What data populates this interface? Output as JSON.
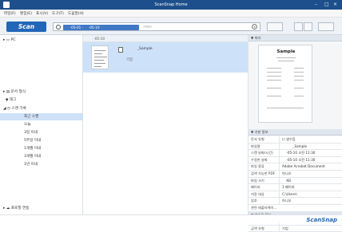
{
  "window": {
    "title": "ScanSnap Home",
    "minimize": "–",
    "maximize": "□",
    "close": "×"
  },
  "menu": [
    "파일(F)",
    "편집(E)",
    "표시(V)",
    "도구(T)",
    "도움말(H)"
  ],
  "toolbar": {
    "scan_label": "Scan",
    "search_chip": "     -05-01 -     -05-10",
    "search_placeholder": "키워드",
    "clear": "×"
  },
  "tree": {
    "pc": "PC",
    "doc_type": "문서 형식",
    "tags": "태그",
    "scan_history": "스캔 기록",
    "history_items": [
      "최근 스캔",
      "오늘",
      "3일 이내",
      "5주일 이내",
      "1개월 이내",
      "3개월 이내",
      "1년 이내"
    ],
    "cloud": "프로필 연동"
  },
  "list": {
    "header": "    -05-10",
    "item": {
      "name": "          _Sample",
      "date": "        ",
      "tag": "기업"
    }
  },
  "preview": {
    "header": "미리",
    "doc_title": "Sample"
  },
  "properties": {
    "header": "기본 정보",
    "rows": [
      {
        "k": "문서 유형",
        "v": "☐ 영수증"
      },
      {
        "k": "파일명",
        "v": "          _Sample"
      },
      {
        "k": "스캔 날짜(시간)",
        "v": "    -05-10 오전 11:30"
      },
      {
        "k": "수정한 날짜",
        "v": "    -05-10 오전 11:30"
      },
      {
        "k": "파일 종류",
        "v": "Adobe Acrobat Document"
      },
      {
        "k": "검색 가능한 PDF",
        "v": "아니오"
      },
      {
        "k": "파일 크기",
        "v": "    KB"
      },
      {
        "k": "페이지",
        "v": "1 페이지"
      },
      {
        "k": "저장 대상",
        "v": "C:\\Users\\            "
      },
      {
        "k": "암호",
        "v": "아니오"
      },
      {
        "k": "관련 애플리케이...",
        "v": ""
      }
    ],
    "header2": "영수증 정보",
    "rows2": [
      {
        "k": "타이틀",
        "v": "Sample"
      },
      {
        "k": "금액 유형",
        "v": "기업"
      }
    ]
  },
  "status": {
    "brand": "ScanSnap"
  },
  "colors": {
    "title_bar": "#1c4f8c",
    "accent": "#2166b8",
    "selection": "#cde2f8"
  }
}
